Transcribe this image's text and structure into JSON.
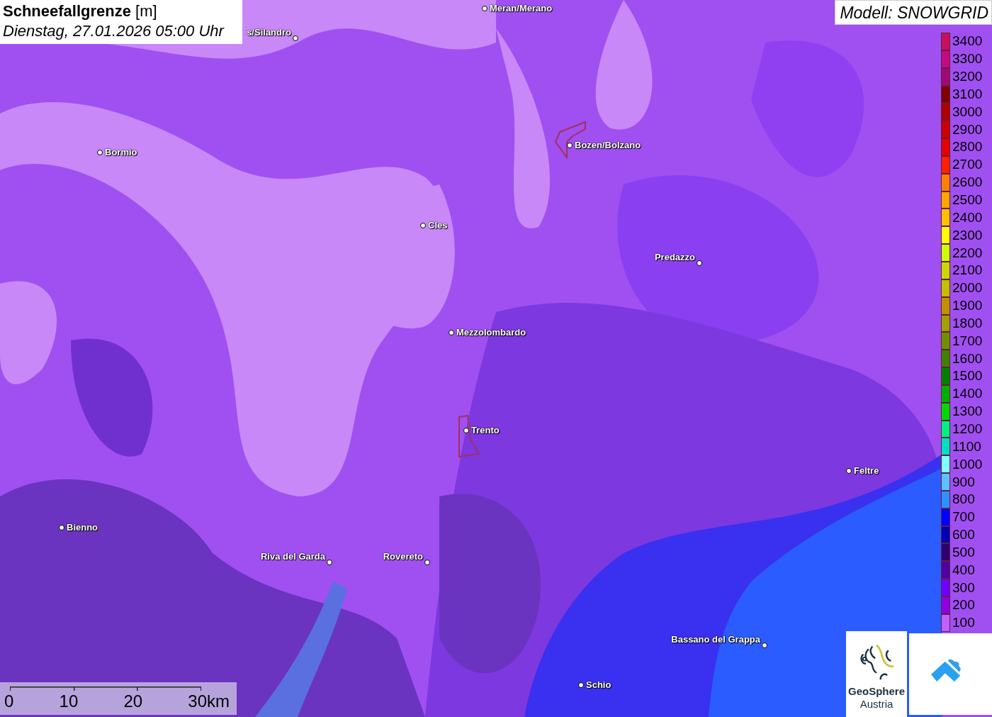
{
  "header": {
    "title": "Schneefallgrenze",
    "unit": "[m]",
    "datetime": "Dienstag, 27.01.2026 05:00 Uhr"
  },
  "model": "Modell: SNOWGRID",
  "cities": [
    {
      "name": "Meran/Merano"
    },
    {
      "name": "s/Silandro"
    },
    {
      "name": "Bormio"
    },
    {
      "name": "Bozen/Bolzano"
    },
    {
      "name": "Cles"
    },
    {
      "name": "Predazzo"
    },
    {
      "name": "Mezzolombardo"
    },
    {
      "name": "Trento"
    },
    {
      "name": "Feltre"
    },
    {
      "name": "Bienno"
    },
    {
      "name": "Riva del Garda"
    },
    {
      "name": "Rovereto"
    },
    {
      "name": "Bassano del Grappa"
    },
    {
      "name": "Schio"
    }
  ],
  "legend": [
    {
      "label": "3400",
      "color": "#c8105e"
    },
    {
      "label": "3300",
      "color": "#c00c80"
    },
    {
      "label": "3200",
      "color": "#a00a78"
    },
    {
      "label": "3100",
      "color": "#800000"
    },
    {
      "label": "3000",
      "color": "#b00000"
    },
    {
      "label": "2900",
      "color": "#cc0000"
    },
    {
      "label": "2800",
      "color": "#e60000"
    },
    {
      "label": "2700",
      "color": "#ff2000"
    },
    {
      "label": "2600",
      "color": "#ff8000"
    },
    {
      "label": "2500",
      "color": "#ffa500"
    },
    {
      "label": "2400",
      "color": "#ffc000"
    },
    {
      "label": "2300",
      "color": "#ffff00"
    },
    {
      "label": "2200",
      "color": "#ccff00"
    },
    {
      "label": "2100",
      "color": "#c8d800"
    },
    {
      "label": "2000",
      "color": "#c0c000"
    },
    {
      "label": "1900",
      "color": "#c09000"
    },
    {
      "label": "1800",
      "color": "#a0a000"
    },
    {
      "label": "1700",
      "color": "#709000"
    },
    {
      "label": "1600",
      "color": "#408000"
    },
    {
      "label": "1500",
      "color": "#008000"
    },
    {
      "label": "1400",
      "color": "#00b000"
    },
    {
      "label": "1300",
      "color": "#00d800"
    },
    {
      "label": "1200",
      "color": "#00f080"
    },
    {
      "label": "1100",
      "color": "#00e0c0"
    },
    {
      "label": "1000",
      "color": "#80ffff"
    },
    {
      "label": "900",
      "color": "#60c0ff"
    },
    {
      "label": "800",
      "color": "#3090ff"
    },
    {
      "label": "700",
      "color": "#0000ff"
    },
    {
      "label": "600",
      "color": "#0000b0"
    },
    {
      "label": "500",
      "color": "#300070"
    },
    {
      "label": "400",
      "color": "#5000a0"
    },
    {
      "label": "300",
      "color": "#7000ff"
    },
    {
      "label": "200",
      "color": "#9000e0"
    },
    {
      "label": "100",
      "color": "#c060ff"
    }
  ],
  "scale": {
    "ticks": [
      "0",
      "10",
      "20",
      "30km"
    ]
  },
  "logos": {
    "geosphere": {
      "line1": "GeoSphere",
      "line2": "Austria"
    }
  }
}
